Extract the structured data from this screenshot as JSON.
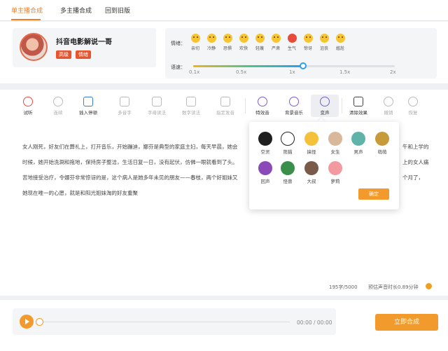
{
  "tabs": [
    {
      "label": "单主播合成",
      "active": true
    },
    {
      "label": "多主播合成",
      "active": false
    },
    {
      "label": "回到旧版",
      "active": false
    }
  ],
  "anchor": {
    "name": "抖音电影解说一哥",
    "tags": [
      "高级",
      "情绪"
    ]
  },
  "emotion": {
    "label": "情绪：",
    "items": [
      {
        "label": "亲切",
        "icon": "smile-face-icon"
      },
      {
        "label": "冷静",
        "icon": "calm-face-icon"
      },
      {
        "label": "恐惧",
        "icon": "fear-face-icon"
      },
      {
        "label": "欢快",
        "icon": "happy-face-icon"
      },
      {
        "label": "轻蔑",
        "icon": "contempt-face-icon"
      },
      {
        "label": "严肃",
        "icon": "serious-face-icon"
      },
      {
        "label": "生气",
        "icon": "angry-face-icon"
      },
      {
        "label": "惊讶",
        "icon": "surprised-face-icon"
      },
      {
        "label": "沮丧",
        "icon": "depressed-face-icon"
      },
      {
        "label": "尴尬",
        "icon": "awkward-face-icon"
      }
    ]
  },
  "speed": {
    "label": "语速：",
    "ticks": [
      "0.1x",
      "0.5x",
      "1x",
      "1.5x",
      "2x"
    ],
    "value": "1x"
  },
  "toolbar": {
    "items": [
      {
        "label": "试听",
        "icon": "play-circle-icon"
      },
      {
        "label": "连续",
        "icon": "link-icon"
      },
      {
        "label": "插入停顿",
        "icon": "pause-insert-icon"
      },
      {
        "label": "多音字",
        "icon": "polyphone-icon"
      },
      {
        "label": "字母读法",
        "icon": "letter-read-icon"
      },
      {
        "label": "数字读法",
        "icon": "number-read-icon"
      },
      {
        "label": "指定发音",
        "icon": "pronunciation-icon"
      },
      {
        "label": "特效音",
        "icon": "sound-effect-icon"
      },
      {
        "label": "背景音乐",
        "icon": "background-music-icon"
      },
      {
        "label": "变声",
        "icon": "voice-change-icon"
      },
      {
        "label": "清除效果",
        "icon": "eraser-icon"
      },
      {
        "label": "撤销",
        "icon": "undo-icon"
      },
      {
        "label": "恢复",
        "icon": "redo-icon"
      }
    ]
  },
  "content": {
    "lines": [
      "女人刚死，好友们在葬礼上，打开音乐，开始蹦迪，娜芬是典型的家庭主妇，每天早晨，她会",
      "时候，她开始洗涮和拖地，保持房子整洁，生活日复一日，没有起伏，仿佛一眼就看到了头。",
      "苦地接受治疗，令娜芬非常惊讶的是，这个病人是她多年未见的朋友——春枝，两个好姐妹又",
      "她现在唯一的心愿，就是和阳光姐妹淘的好友重聚"
    ],
    "overflow_right": [
      "午和上学的",
      "上的女人痛",
      "个月了，"
    ]
  },
  "counter": {
    "chars": "195字/5000",
    "duration": "预估声音时长0.89分钟"
  },
  "voice_popup": {
    "options": [
      {
        "label": "空灵",
        "icon": "ethereal-voice-icon",
        "color": "#1f1f1f"
      },
      {
        "label": "熊猫",
        "icon": "panda-voice-icon",
        "color": "#ffffff"
      },
      {
        "label": "搞怪",
        "icon": "funny-voice-icon",
        "color": "#f3c23a"
      },
      {
        "label": "女生",
        "icon": "female-voice-icon",
        "color": "#d9b79a"
      },
      {
        "label": "男声",
        "icon": "male-voice-icon",
        "color": "#5fb3a8"
      },
      {
        "label": "萌萌",
        "icon": "cute-voice-icon",
        "color": "#c79a3a"
      },
      {
        "label": "回声",
        "icon": "echo-voice-icon",
        "color": "#8a4bb8"
      },
      {
        "label": "怪兽",
        "icon": "monster-voice-icon",
        "color": "#3a8f4a"
      },
      {
        "label": "大叔",
        "icon": "uncle-voice-icon",
        "color": "#7a5a48"
      },
      {
        "label": "萝莉",
        "icon": "loli-voice-icon",
        "color": "#f29aa0"
      }
    ],
    "confirm_label": "确定"
  },
  "player": {
    "time": "00:00 / 00:00",
    "synth_label": "立即合成"
  },
  "colors": {
    "accent": "#f39a2c",
    "active_tab": "#f57d1f",
    "tag": "#e8552d"
  }
}
